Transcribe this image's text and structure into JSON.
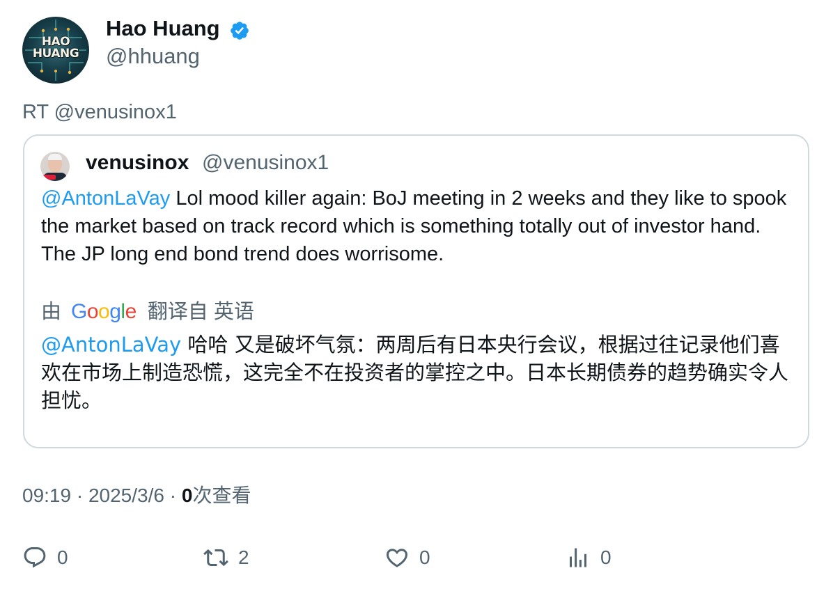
{
  "author": {
    "display_name": "Hao Huang",
    "handle": "@hhuang",
    "avatar_text": "HAO\nHUANG",
    "verified": true
  },
  "retweet_text": "RT @venusinox1",
  "quoted": {
    "display_name": "venusinox",
    "handle": "@venusinox1",
    "mention": "@AntonLaVay",
    "text": " Lol mood killer again: BoJ meeting in 2 weeks and they like to spook the market based on track record which is something totally out of investor hand. The JP long end bond trend does worrisome.",
    "translation_prefix": "由",
    "translation_provider": "Google",
    "translation_suffix": "翻译自 英语",
    "translated_mention": "@AntonLaVay",
    "translated_text": " 哈哈 又是破坏气氛：两周后有日本央行会议，根据过往记录他们喜欢在市场上制造恐慌，这完全不在投资者的掌控之中。日本长期债券的趋势确实令人担忧。"
  },
  "meta": {
    "time": "09:19",
    "separator": "·",
    "date": "2025/3/6",
    "views_count": "0",
    "views_label": "次查看"
  },
  "actions": {
    "replies": "0",
    "retweets": "2",
    "likes": "0",
    "views": "0"
  },
  "colors": {
    "accent": "#1d9bf0",
    "secondary_text": "#536471",
    "border": "#cfd9de"
  }
}
